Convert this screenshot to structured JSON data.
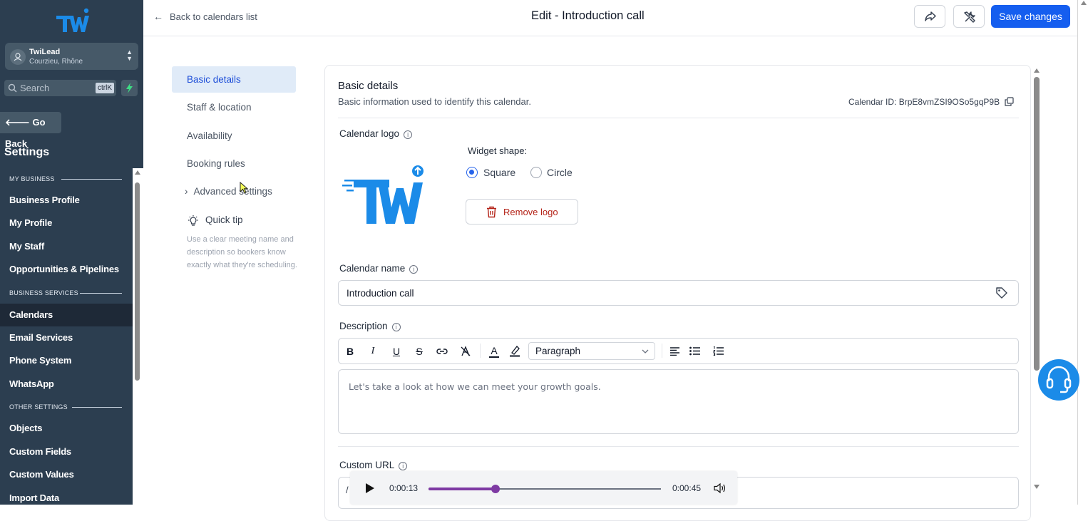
{
  "sidebar": {
    "account": {
      "name": "TwiLead",
      "location": "Courzieu, Rhône"
    },
    "search": {
      "placeholder": "Search",
      "shortcut": "ctrlK"
    },
    "go_back": "Go Back",
    "title": "Settings",
    "sections": {
      "my_business": "MY BUSINESS",
      "business_services": "BUSINESS SERVICES",
      "other_settings": "OTHER SETTINGS"
    },
    "items": [
      "Business Profile",
      "My Profile",
      "My Staff",
      "Opportunities & Pipelines",
      "Calendars",
      "Email Services",
      "Phone System",
      "WhatsApp",
      "Objects",
      "Custom Fields",
      "Custom Values",
      "Import Data"
    ],
    "active_item": "Calendars"
  },
  "header": {
    "back_label": "Back to calendars list",
    "title": "Edit - Introduction call",
    "save_label": "Save changes"
  },
  "subnav": {
    "items": [
      "Basic details",
      "Staff & location",
      "Availability",
      "Booking rules",
      "Advanced settings"
    ],
    "active": "Basic details",
    "tip_title": "Quick tip",
    "tip_text": "Use a clear meeting name and description so bookers know exactly what they're scheduling."
  },
  "basic": {
    "title": "Basic details",
    "subtitle": "Basic information used to identify this calendar.",
    "calendar_id": "Calendar ID: BrpE8vmZSI9OSo5gqP9B",
    "logo_label": "Calendar logo",
    "widget_shape_label": "Widget shape:",
    "shape_options": [
      "Square",
      "Circle"
    ],
    "shape_selected": "Square",
    "remove_logo": "Remove logo",
    "name_label": "Calendar name",
    "name_value": "Introduction call",
    "description_label": "Description",
    "paragraph_select": "Paragraph",
    "description_placeholder": "Let's take a look at how we can meet your growth goals.",
    "custom_url_label": "Custom URL",
    "custom_url_prefix": "/"
  },
  "player": {
    "current": "0:00:13",
    "total": "0:00:45",
    "progress": 0.289
  },
  "colors": {
    "sidebar": "#2c3e50",
    "primary": "#155eef",
    "active_nav": "#e0ebf8",
    "player_accent": "#7e3aa3",
    "support": "#1b8be8"
  }
}
